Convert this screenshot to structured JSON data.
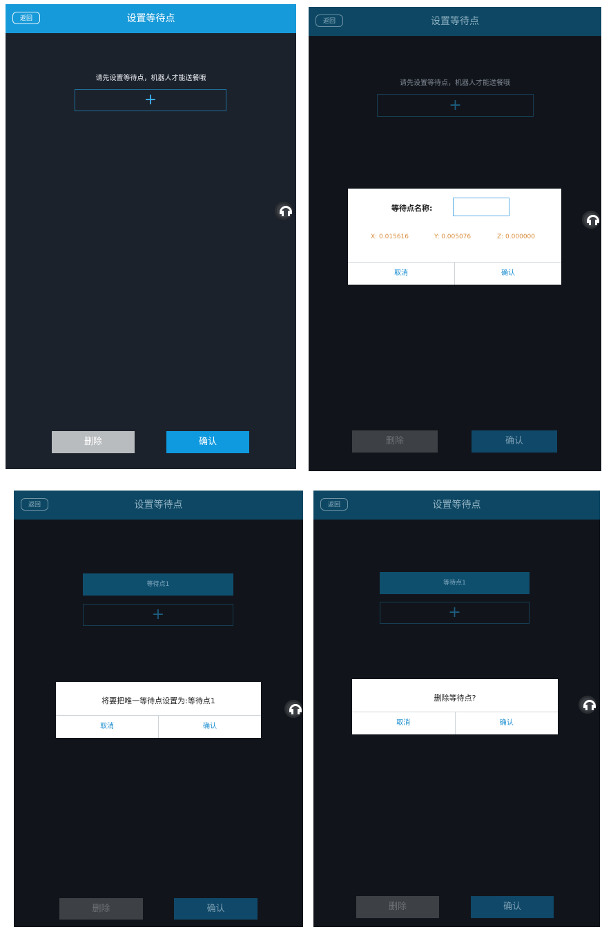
{
  "screens": [
    {
      "back_label": "返回",
      "title": "设置等待点",
      "hint": "请先设置等待点，机器人才能送餐哦",
      "add_symbol": "+",
      "delete_label": "删除",
      "confirm_label": "确认"
    },
    {
      "back_label": "返回",
      "title": "设置等待点",
      "hint": "请先设置等待点，机器人才能送餐哦",
      "add_symbol": "+",
      "delete_label": "删除",
      "confirm_label": "确认",
      "dialog": {
        "name_label": "等待点名称:",
        "name_value": "",
        "x": "X: 0.015616",
        "y": "Y: 0.005076",
        "z": "Z: 0.000000",
        "cancel_label": "取消",
        "confirm_label": "确认"
      }
    },
    {
      "back_label": "返回",
      "title": "设置等待点",
      "point_item": "等待点1",
      "add_symbol": "+",
      "delete_label": "删除",
      "confirm_label": "确认",
      "dialog": {
        "message": "将要把唯一等待点设置为:等待点1",
        "cancel_label": "取消",
        "confirm_label": "确认"
      }
    },
    {
      "back_label": "返回",
      "title": "设置等待点",
      "point_item": "等待点1",
      "add_symbol": "+",
      "delete_label": "删除",
      "confirm_label": "确认",
      "dialog": {
        "message": "删除等待点?",
        "cancel_label": "取消",
        "confirm_label": "确认"
      }
    }
  ],
  "colors": {
    "accent": "#179ad9",
    "background": "#1c222c",
    "coord_text": "#d98c3c"
  },
  "icons": [
    "robot-headset-icon"
  ]
}
